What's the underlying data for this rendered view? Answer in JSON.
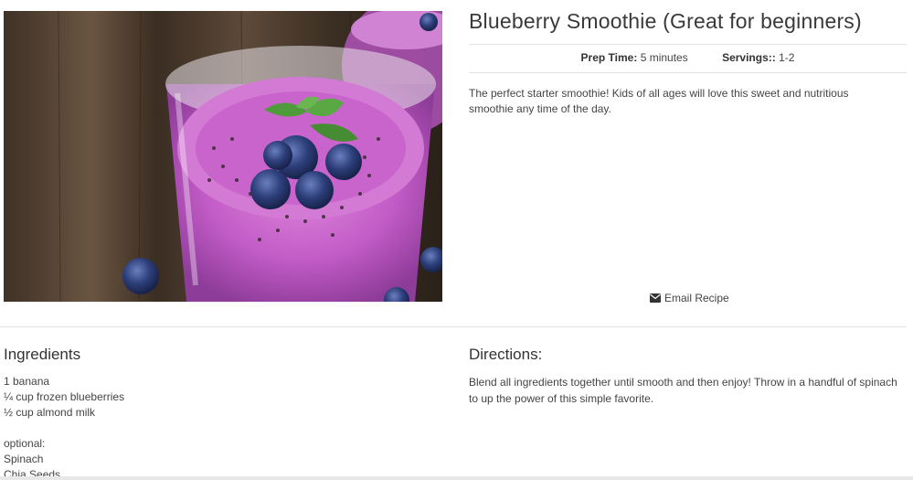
{
  "recipe": {
    "image_alt": "Blueberry smoothie in a glass topped with blueberries, chia seeds and mint",
    "title": "Blueberry Smoothie (Great for beginners)",
    "prep_time_label": "Prep Time:",
    "prep_time_value": "5 minutes",
    "servings_label": "Servings::",
    "servings_value": "1-2",
    "description": "The perfect starter smoothie! Kids of all ages will love this sweet and nutritious smoothie any time of the day.",
    "email_label": "Email Recipe",
    "email_icon": "envelope-icon"
  },
  "ingredients": {
    "heading": "Ingredients",
    "items": [
      "1 banana",
      "¼ cup frozen blueberries",
      "½ cup almond milk"
    ],
    "optional_label": "optional:",
    "optional_items": [
      "Spinach",
      "Chia Seeds"
    ]
  },
  "directions": {
    "heading": "Directions:",
    "text": "Blend all ingredients together until smooth and then enjoy! Throw in a handful of spinach to up the power of this simple favorite."
  },
  "colors": {
    "smoothie": "#c25bc6",
    "blueberry": "#2d3f7a",
    "mint": "#4f9a3a",
    "wood": "#4a3a2c"
  }
}
